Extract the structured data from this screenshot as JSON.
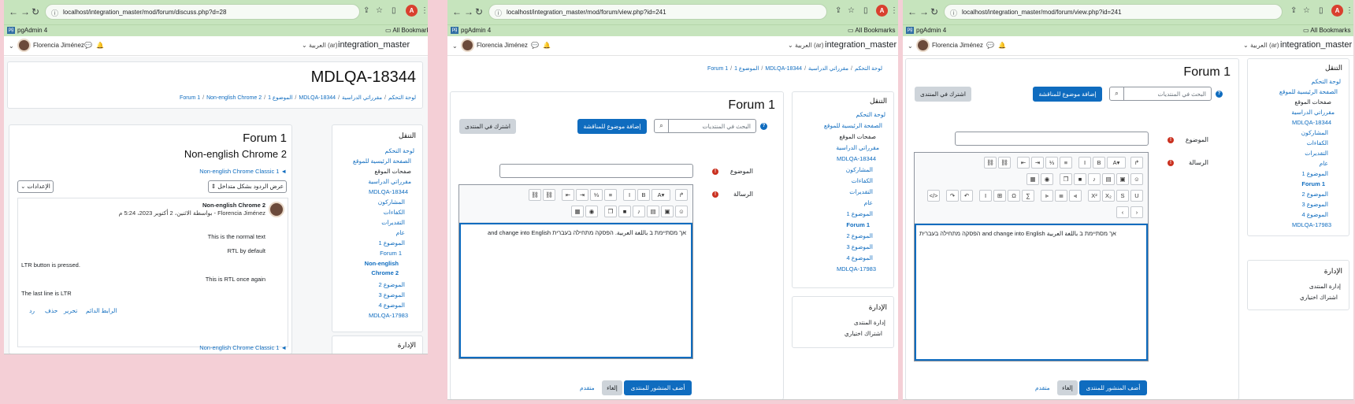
{
  "panes": {
    "left": {
      "url": "localhost/integration_master/mod/forum/discuss.php?d=28",
      "course_title": "MDLQA-18344",
      "breadcrumb": [
        "لوحة التحكم",
        "مقرراتي الدراسية",
        "MDLQA-18344",
        "الموضوع 1",
        "Forum 1",
        "Non-english Chrome 2"
      ],
      "forum_title": "Forum 1",
      "discussion_title": "Non-english Chrome 2",
      "prev_link": "Non-english Chrome Classic 1 ◄",
      "display_mode": "عرض الردود بشكل متداخل",
      "settings_label": "الإعدادات",
      "post_subject": "Non-english Chrome 2",
      "post_by": "بواسطة الاثنين، 2 أكتوبر 2023، 5:24 م - Florencia Jiménez",
      "post_lines": [
        "This is the normal text",
        "RTL by default",
        "LTR button is pressed.",
        "This is RTL once again",
        "The last line is LTR"
      ],
      "post_actions": [
        "الرابط الدائم",
        "تحرير",
        "حذف",
        "رد"
      ],
      "next_link": "Non-english Chrome Classic 1 ◄",
      "nav_heading": "التنقل",
      "nav_items": [
        "لوحة التحكم",
        "الصفحة الرئيسية للموقع",
        "صفحات الموقع",
        "مقرراتي الدراسية",
        "MDLQA-18344",
        "المشاركون",
        "الكفاءات",
        "التقديرات",
        "عام",
        "الموضوع 1",
        "Forum 1",
        "Non-english",
        "Chrome 2",
        "الموضوع 2",
        "الموضوع 3",
        "الموضوع 4",
        "MDLQA-17983"
      ],
      "admin_heading": "الإدارة"
    },
    "middle": {
      "url": "localhost/integration_master/mod/forum/view.php?id=241",
      "breadcrumb": [
        "لوحة التحكم",
        "مقرراتي الدراسية",
        "MDLQA-18344",
        "الموضوع 1",
        "Forum 1"
      ],
      "forum_title": "Forum 1",
      "search_placeholder": "البحث في المنتديات",
      "add_topic": "إضافة موضوع للمناقشة",
      "subscribe": "اشترك في المنتدى",
      "subject_label": "الموضوع",
      "message_label": "الرسالة",
      "editor_text": "אך מסתיימת ב باللغة العربية. הפסקה מתחילה בעברית and change into English",
      "post_btn": "أضف المنشور للمنتدى",
      "cancel_btn": "إلغاء",
      "advanced_link": "متقدم",
      "nav_heading": "التنقل",
      "nav_items": [
        "لوحة التحكم",
        "الصفحة الرئيسية للموقع",
        "صفحات الموقع",
        "مقرراتي الدراسية",
        "MDLQA-18344",
        "المشاركون",
        "الكفاءات",
        "التقديرات",
        "عام",
        "الموضوع 1",
        "Forum 1",
        "الموضوع 2",
        "الموضوع 3",
        "الموضوع 4",
        "MDLQA-17983"
      ],
      "admin_heading": "الإدارة",
      "admin_items": [
        "إدارة المنتدى",
        "اشتراك اختياري"
      ]
    },
    "right": {
      "url": "localhost/integration_master/mod/forum/view.php?id=241",
      "forum_title": "Forum 1",
      "search_placeholder": "البحث في المنتديات",
      "add_topic": "إضافة موضوع للمناقشة",
      "subscribe": "اشترك في المنتدى",
      "subject_label": "الموضوع",
      "message_label": "الرسالة",
      "editor_text": "אך מסתיימת ב باللغة العربية and change into English הפסקה מתחילה בעברית",
      "post_btn": "أضف المنشور للمنتدى",
      "cancel_btn": "إلغاء",
      "advanced_link": "متقدم",
      "nav_heading": "التنقل",
      "nav_items": [
        "لوحة التحكم",
        "الصفحة الرئيسية للموقع",
        "صفحات الموقع",
        "مقرراتي الدراسية",
        "MDLQA-18344",
        "المشاركون",
        "الكفاءات",
        "التقديرات",
        "عام",
        "الموضوع 1",
        "Forum 1",
        "الموضوع 2",
        "الموضوع 3",
        "الموضوع 4",
        "MDLQA-17983"
      ],
      "admin_heading": "الإدارة",
      "admin_items": [
        "إدارة المنتدى",
        "اشتراك اختياري"
      ]
    }
  },
  "common": {
    "bookmark_pgadmin": "pgAdmin 4",
    "all_bookmarks": "All Bookmarks",
    "user_name": "Florencia Jiménez",
    "lang": "العربية (ar)",
    "site": "integration_master",
    "avatar_letter": "A"
  },
  "colors": {
    "accent": "#0f6cbf",
    "chrome_green": "#c6e4bd",
    "page_bg": "#f4cfd6"
  }
}
